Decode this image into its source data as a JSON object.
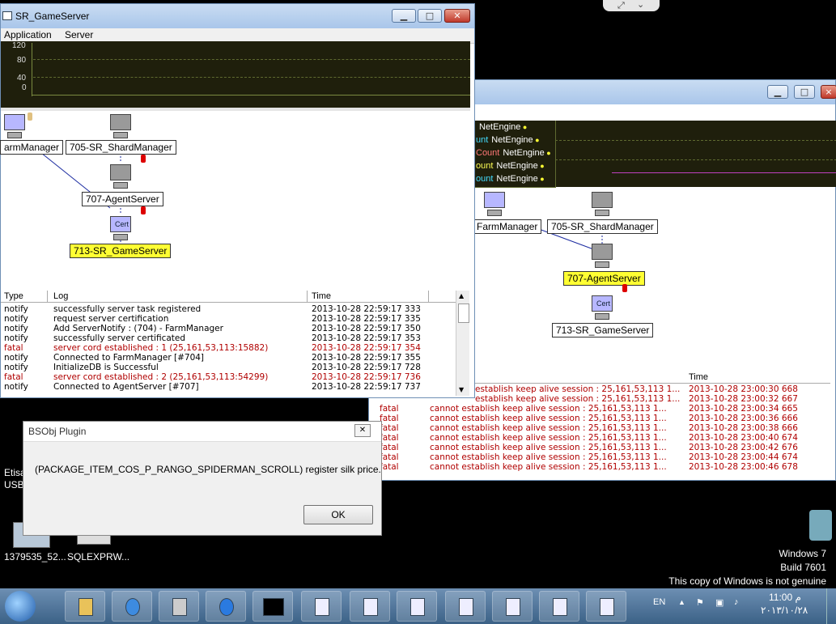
{
  "colors": {
    "desktop": "#000000",
    "graph_bg": "#1f1f0c",
    "highlight": "#ffff33",
    "fatal": "#b00000"
  },
  "main_window": {
    "title": "SR_GameServer",
    "menu": [
      "Application",
      "Server"
    ],
    "graph_ticks": [
      "120",
      "80",
      "40",
      "0"
    ],
    "nodes": {
      "farm_manager": "armManager",
      "shard_manager": "705-SR_ShardManager",
      "agent_server": "707-AgentServer",
      "game_server": "713-SR_GameServer",
      "cert": "Cert"
    },
    "log_headers": {
      "type": "Type",
      "log": "Log",
      "time": "Time"
    },
    "log_rows": [
      {
        "type": "notify",
        "log": "successfully server task registered",
        "time": "2013-10-28 22:59:17 333"
      },
      {
        "type": "notify",
        "log": "request server certification",
        "time": "2013-10-28 22:59:17 335"
      },
      {
        "type": "notify",
        "log": "Add ServerNotify : (704) - FarmManager",
        "time": "2013-10-28 22:59:17 350"
      },
      {
        "type": "notify",
        "log": "successfully server certificated",
        "time": "2013-10-28 22:59:17 353"
      },
      {
        "type": "fatal",
        "log": "server cord established : 1 (25,161,53,113:15882)",
        "time": "2013-10-28 22:59:17 354"
      },
      {
        "type": "notify",
        "log": "Connected to FarmManager [#704]",
        "time": "2013-10-28 22:59:17 355"
      },
      {
        "type": "notify",
        "log": "InitializeDB is Successful",
        "time": "2013-10-28 22:59:17 728"
      },
      {
        "type": "fatal",
        "log": "server cord established : 2 (25,161,53,113:54299)",
        "time": "2013-10-28 22:59:17 736"
      },
      {
        "type": "notify",
        "log": "Connected to AgentServer [#707]",
        "time": "2013-10-28 22:59:17 737"
      }
    ]
  },
  "second_window": {
    "legend": [
      {
        "label": "NetEngine",
        "prefix": ""
      },
      {
        "label": "NetEngine",
        "prefix": "unt"
      },
      {
        "label": "NetEngine",
        "prefix": "Count"
      },
      {
        "label": "NetEngine",
        "prefix": "ount"
      },
      {
        "label": "NetEngine",
        "prefix": "ount"
      }
    ],
    "nodes": {
      "farm_manager": "FarmManager",
      "shard_manager": "705-SR_ShardManager",
      "agent_server": "707-AgentServer",
      "game_server": "713-SR_GameServer",
      "cert": "Cert"
    },
    "log_time_header": "Time",
    "log_rows": [
      {
        "type": "",
        "log": "establish keep alive session : 25,161,53,113 1...",
        "time": "2013-10-28 23:00:30 668"
      },
      {
        "type": "",
        "log": "establish keep alive session : 25,161,53,113 1...",
        "time": "2013-10-28 23:00:32 667"
      },
      {
        "type": "fatal",
        "log": "cannot establish keep alive session : 25,161,53,113 1...",
        "time": "2013-10-28 23:00:34 665"
      },
      {
        "type": "fatal",
        "log": "cannot establish keep alive session : 25,161,53,113 1...",
        "time": "2013-10-28 23:00:36 666"
      },
      {
        "type": "fatal",
        "log": "cannot establish keep alive session : 25,161,53,113 1...",
        "time": "2013-10-28 23:00:38 666"
      },
      {
        "type": "fatal",
        "log": "cannot establish keep alive session : 25,161,53,113 1...",
        "time": "2013-10-28 23:00:40 674"
      },
      {
        "type": "fatal",
        "log": "cannot establish keep alive session : 25,161,53,113 1...",
        "time": "2013-10-28 23:00:42 676"
      },
      {
        "type": "fatal",
        "log": "cannot establish keep alive session : 25,161,53,113 1...",
        "time": "2013-10-28 23:00:44 674"
      },
      {
        "type": "fatal",
        "log": "cannot establish keep alive session : 25,161,53,113 1...",
        "time": "2013-10-28 23:00:46 678"
      }
    ]
  },
  "dialog": {
    "title": "BSObj Plugin",
    "message": "(PACKAGE_ITEM_COS_P_RANGO_SPIDERMAN_SCROLL) register silk price.",
    "ok_label": "OK"
  },
  "desktop": {
    "icon_left_top": "Etisa",
    "icon_left_bottom": "USB",
    "icon_1": "1379535_52...",
    "icon_2": "SQLEXPRW...",
    "watermark": [
      "Windows 7",
      "Build 7601",
      "This copy of Windows is not genuine"
    ]
  },
  "tray": {
    "lang": "EN",
    "time": "11:00 م",
    "date": "٢٠١٣/١٠/٢٨"
  }
}
